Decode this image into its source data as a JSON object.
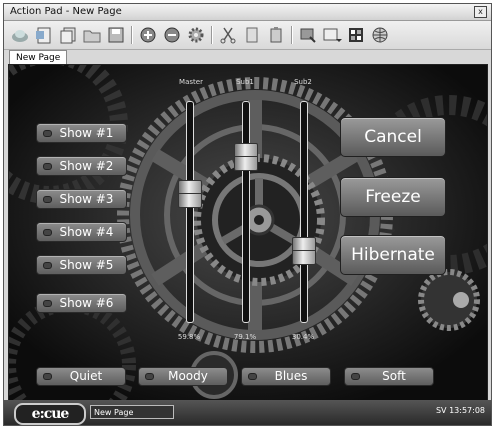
{
  "window": {
    "title": "Action Pad - New Page",
    "close_label": "x"
  },
  "toolbar": {
    "icons": [
      "cloud-icon",
      "new-doc-icon",
      "copy-doc-icon",
      "folder-open-icon",
      "save-icon",
      "add-icon",
      "remove-icon",
      "gear-icon",
      "cut-icon",
      "copy-icon",
      "paste-icon",
      "properties-icon",
      "page-dropdown-icon",
      "grid-icon",
      "globe-icon"
    ]
  },
  "tabs": [
    {
      "label": "New Page"
    }
  ],
  "stage": {
    "show_buttons": [
      "Show #1",
      "Show #2",
      "Show #3",
      "Show #4",
      "Show #5",
      "Show #6"
    ],
    "action_buttons": [
      "Cancel",
      "Freeze",
      "Hibernate"
    ],
    "bottom_buttons": [
      "Quiet",
      "Moody",
      "Blues",
      "Soft"
    ],
    "faders": [
      {
        "name": "Master",
        "value": "59.8%",
        "level": 0.598
      },
      {
        "name": "Sub1",
        "value": "79.1%",
        "level": 0.791
      },
      {
        "name": "Sub2",
        "value": "30.4%",
        "level": 0.304
      }
    ]
  },
  "status": {
    "logo": "e:cue",
    "page": "New Page",
    "server": "SV 13:57:08"
  }
}
